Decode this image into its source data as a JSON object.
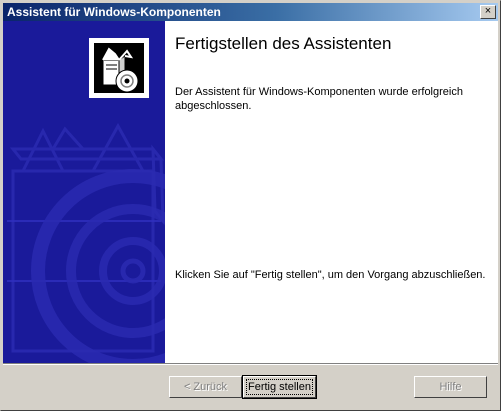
{
  "window": {
    "title": "Assistent für Windows-Komponenten",
    "close_glyph": "×"
  },
  "content": {
    "heading": "Fertigstellen des Assistenten",
    "description": "Der Assistent für Windows-Komponenten wurde erfolgreich abgeschlossen.",
    "instruction": "Klicken Sie auf \"Fertig stellen\", um den Vorgang abzuschließen."
  },
  "buttons": {
    "back": "< Zurück",
    "finish": "Fertig stellen",
    "help": "Hilfe"
  },
  "colors": {
    "titlebar_start": "#0a246a",
    "banner": "#1a1a9a",
    "face": "#d4d0c8"
  }
}
